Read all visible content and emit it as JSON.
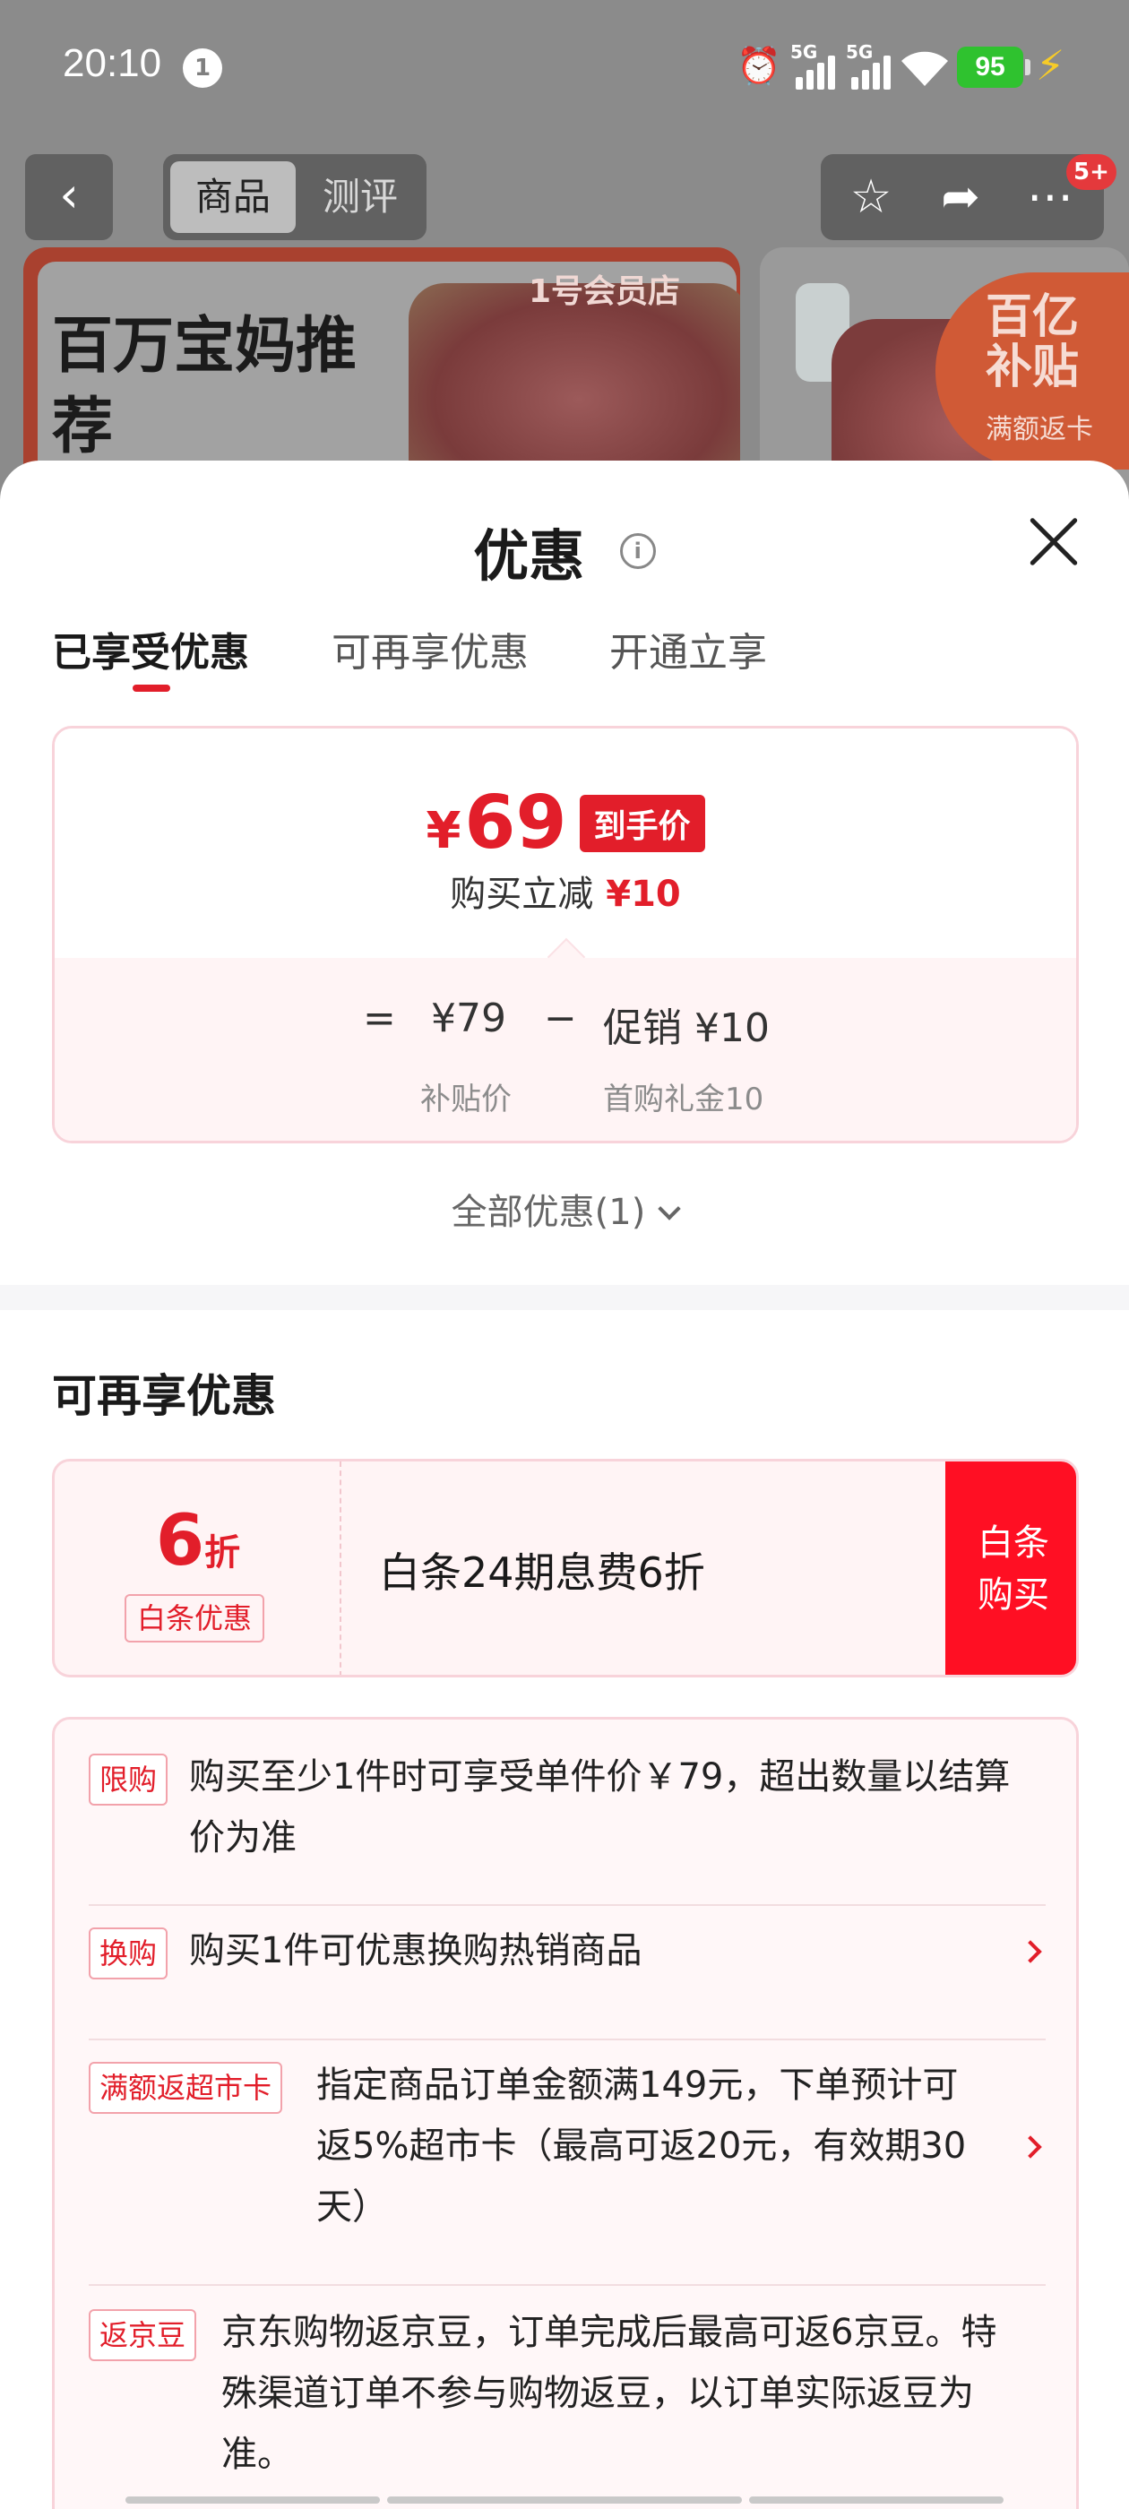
{
  "status_bar": {
    "time": "20:10",
    "notification_count": "1",
    "network_1": "5G",
    "network_2": "5G",
    "battery": "95"
  },
  "top_bar": {
    "tabs": [
      "商品",
      "测评"
    ],
    "active_tab": "商品",
    "badge": "5+"
  },
  "banner": {
    "title": "百万宝妈推荐",
    "store_logo": "1号会员店",
    "subsidy_line1": "百亿补贴",
    "subsidy_line2": "满额返卡"
  },
  "sheet": {
    "title": "优惠",
    "tabs": [
      "已享受优惠",
      "可再享优惠",
      "开通立享"
    ],
    "active_tab": "已享受优惠",
    "price_card": {
      "currency": "¥",
      "final_price": "69",
      "final_price_tag": "到手价",
      "reduce_label": "购买立减",
      "reduce_value": "¥10",
      "equals": "=",
      "base_price": "¥79",
      "minus": "−",
      "promo_price": "促销 ¥10",
      "base_price_label": "补贴价",
      "promo_label": "首购礼金10"
    },
    "all_promos_link": "全部优惠(1)",
    "more_section_title": "可再享优惠",
    "coupon": {
      "discount_num": "6",
      "discount_unit": "折",
      "tag": "白条优惠",
      "description": "白条24期息费6折",
      "button_line1": "白条",
      "button_line2": "购买"
    },
    "rules": [
      {
        "tag": "限购",
        "lines": [
          "购买至少1件时可享受单件价￥79，超出数量以结算",
          "价为准"
        ]
      },
      {
        "tag": "换购",
        "lines": [
          "购买1件可优惠换购热销商品"
        ]
      },
      {
        "tag": "满额返超市卡",
        "lines": [
          "指定商品订单金额满149元，下单预计可",
          "返5%超市卡（最高可返20元，有效期30",
          "天）"
        ]
      },
      {
        "tag": "返京豆",
        "lines": [
          "京东购物返京豆，订单完成后最高可返6京豆。特",
          "殊渠道订单不参与购物返豆，以订单实际返豆为",
          "准。"
        ]
      }
    ]
  },
  "colors": {
    "accent_red": "#e21e2a",
    "button_red": "#ff0f23",
    "card_border": "#f8d3da",
    "card_bg": "#fff4f5",
    "battery_green": "#2fc22f"
  }
}
